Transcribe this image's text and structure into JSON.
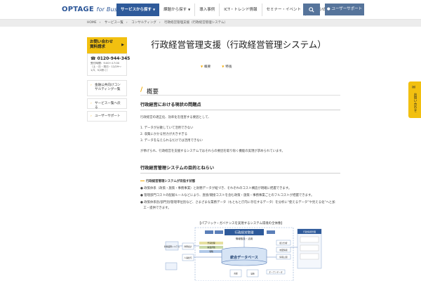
{
  "header": {
    "logo_main": "OPTAGE",
    "logo_sub": "for Business",
    "nav": [
      {
        "label": "サービスから探す",
        "active": true,
        "chevron": true
      },
      {
        "label": "課題から探す",
        "active": false,
        "chevron": true
      },
      {
        "label": "導入事例",
        "active": false,
        "chevron": false
      },
      {
        "label": "ICT・トレンド情報",
        "active": false,
        "chevron": false
      },
      {
        "label": "セミナー・イベント",
        "active": false,
        "chevron": false
      },
      {
        "label": "お知らせ",
        "active": false,
        "chevron": false
      }
    ],
    "search_icon": "search-icon",
    "user_button": "ユーザーサポート"
  },
  "breadcrumb": [
    "HOME",
    "サービス一覧",
    "コンサルティング",
    "行政経営管理支援（行政経営管理システム）"
  ],
  "sidebar": {
    "cta_label_1": "お問い合わせ",
    "cta_label_2": "資料請求",
    "phone": "0120-944-345",
    "hours_1": "受付時間：9:00～17:00",
    "hours_2": "（土・日・祝日・12/29～",
    "hours_3": "1/3、5/1除く）",
    "links": [
      "金融公共向けコンサルティング一覧",
      "サービス一覧へ戻る",
      "ユーザーサポート"
    ]
  },
  "main": {
    "title": "行政経営管理支援（行政経営管理システム）",
    "anchors": [
      "概要",
      "特長"
    ],
    "section_label": "概要",
    "h3_1": "行政経営における現状の問題点",
    "intro": "行政経営の適正化、効率化を阻害する要因として、",
    "problems": [
      "1. データが分散していて活用できない",
      "2. 収集にかかる労力が大きすぎる",
      "3. データを与えられるだけでは活用できない"
    ],
    "problems_note": "が挙げられ、行政経営を支援するシステムではそれらの要因を取り除く機能の実現が求められています。",
    "h3_2": "行政経営管理システムの目的とねらい",
    "goal_title": "行政経営管理システムが目指す状態",
    "goals": [
      "● 政策体系（政策・施策・事務事業）と財務データが紐づき、それぞれのコスト構造が明確に把握できます。",
      "● 管理部門コストの配賦ルールなどにより、直接/間接コストを含む政策・施策・事務事業ごとのフルコストが把握できます。",
      "● 政策体系別/部門別/管理単位別など、さまざまな業務データ（もともと庁内に存在するデータ）を分析に“使えるデータ”や見える化”へと加",
      "　工・提供できます。"
    ],
    "diagram_caption": "【パブリック・ガバナンスを実現するシステム環境の全体像】",
    "diagram_labels": {
      "top_box": "行政経営管理",
      "top_sub": "情報取扱・活用",
      "db": "統合データベース",
      "right_head": "行政情報管理",
      "left_1": "各種業務システム",
      "left_2": "財務会計",
      "left_3": "人事給与",
      "bar_1": "予算管理",
      "bar_2": "事業評価",
      "bar_3": "戦略",
      "side_1": "統計分析",
      "side_2": "地図情報",
      "side_3": "情報公開",
      "bottom_1": "オープンデータ",
      "bottom_2": "市民",
      "bottom_3": "議会"
    }
  },
  "float_tab": {
    "icon": "mail-icon",
    "label": "お問い合わせ"
  },
  "colors": {
    "brand_blue": "#2e5a9a",
    "accent_yellow": "#f2c010",
    "accent_orange": "#f2a900"
  }
}
